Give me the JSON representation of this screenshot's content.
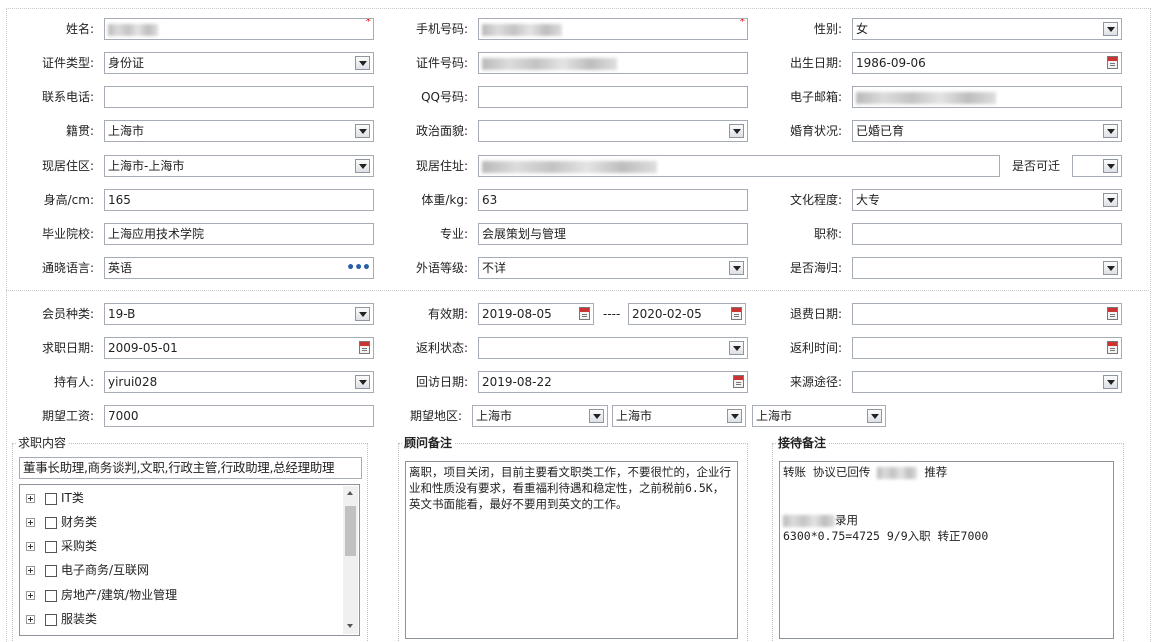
{
  "personal": {
    "name_label": "姓名:",
    "phone_label": "手机号码:",
    "gender_label": "性别:",
    "gender": "女",
    "id_type_label": "证件类型:",
    "id_type": "身份证",
    "id_no_label": "证件号码:",
    "birth_label": "出生日期:",
    "birth": "1986-09-06",
    "contact_label": "联系电话:",
    "qq_label": "QQ号码:",
    "email_label": "电子邮箱:",
    "origin_label": "籍贯:",
    "origin": "上海市",
    "politics_label": "政治面貌:",
    "marital_label": "婚育状况:",
    "marital": "已婚已育",
    "residence_label": "现居住区:",
    "residence": "上海市-上海市",
    "address_label": "现居住址:",
    "relocate_label": "是否可迁",
    "height_label": "身高/cm:",
    "height": "165",
    "weight_label": "体重/kg:",
    "weight": "63",
    "education_label": "文化程度:",
    "education": "大专",
    "school_label": "毕业院校:",
    "school": "上海应用技术学院",
    "major_label": "专业:",
    "major": "会展策划与管理",
    "title_label": "职称:",
    "language_label": "通晓语言:",
    "language": "英语",
    "foreign_level_label": "外语等级:",
    "foreign_level": "不详",
    "overseas_label": "是否海归:"
  },
  "membership": {
    "type_label": "会员种类:",
    "type": "19-B",
    "valid_label": "有效期:",
    "valid_from": "2019-08-05",
    "valid_sep": "----",
    "valid_to": "2020-02-05",
    "refund_label": "退费日期:",
    "job_date_label": "求职日期:",
    "job_date": "2009-05-01",
    "rebate_status_label": "返利状态:",
    "rebate_time_label": "返利时间:",
    "holder_label": "持有人:",
    "holder": "yirui028",
    "visit_label": "回访日期:",
    "visit": "2019-08-22",
    "source_label": "来源途径:",
    "salary_label": "期望工资:",
    "salary": "7000",
    "region_label": "期望地区:",
    "region1": "上海市",
    "region2": "上海市",
    "region3": "上海市"
  },
  "job_content": {
    "legend": "求职内容",
    "selected": "董事长助理,商务谈判,文职,行政主管,行政助理,总经理助理",
    "tree": [
      "IT类",
      "财务类",
      "采购类",
      "电子商务/互联网",
      "房地产/建筑/物业管理",
      "服装类"
    ]
  },
  "consultant": {
    "legend": "顾问备注",
    "text": "离职，项目关闭，目前主要看文职类工作，不要很忙的，企业行业和性质没有要求，看重福利待遇和稳定性，之前税前6.5K，英文书面能看，最好不要用到英文的工作。"
  },
  "reception": {
    "legend": "接待备注",
    "line1_a": "转账 协议已回传",
    "line1_b": "推荐",
    "line2": "录用",
    "line3": "6300*0.75=4725  9/9入职  转正7000"
  },
  "colors": {
    "required": "#e00000",
    "border": "#a5acb5"
  }
}
